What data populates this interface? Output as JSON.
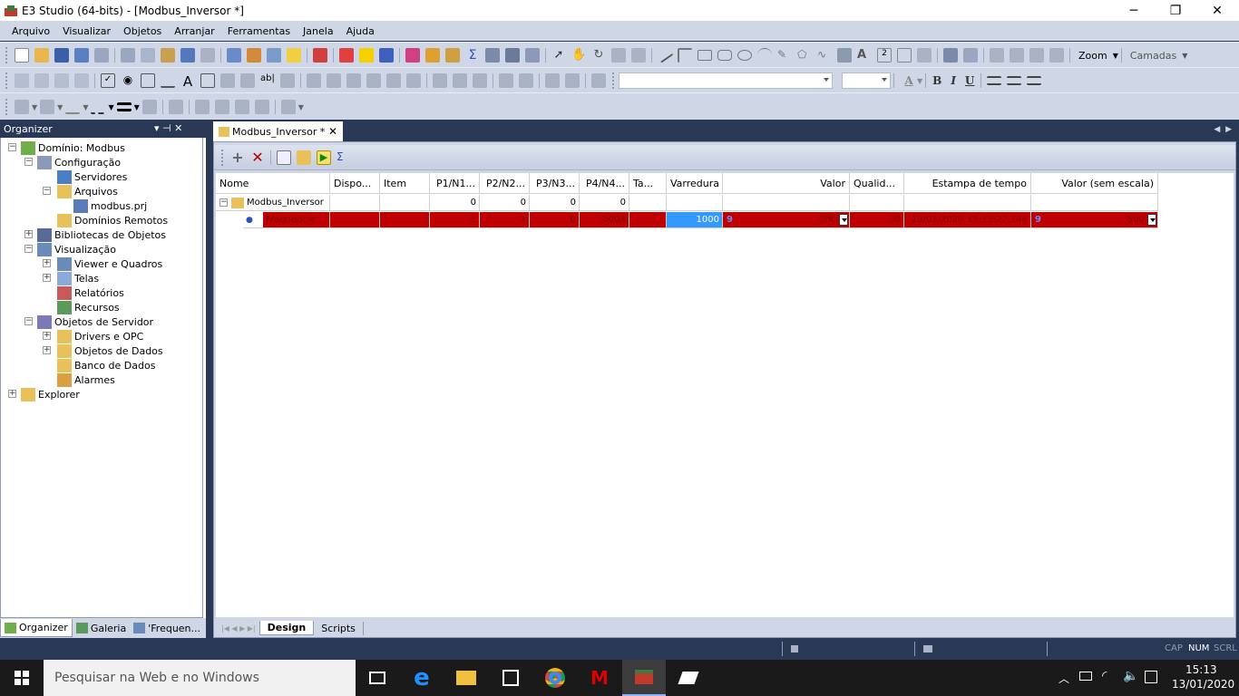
{
  "window": {
    "title": "E3 Studio (64-bits) - [Modbus_Inversor *]",
    "minimize": "─",
    "maximize": "❐",
    "close": "✕"
  },
  "menu": [
    "Arquivo",
    "Visualizar",
    "Objetos",
    "Arranjar",
    "Ferramentas",
    "Janela",
    "Ajuda"
  ],
  "toolbar": {
    "zoom": "Zoom",
    "camadas": "Camadas"
  },
  "organizer": {
    "title": "Organizer",
    "pin": "▾  ⊣  ✕",
    "tree": [
      "Domínio: Modbus",
      "Configuração",
      "Servidores",
      "Arquivos",
      "modbus.prj",
      "Domínios Remotos",
      "Bibliotecas de Objetos",
      "Visualização",
      "Viewer e Quadros",
      "Telas",
      "Relatórios",
      "Recursos",
      "Objetos de Servidor",
      "Drivers e OPC",
      "Objetos de Dados",
      "Banco de Dados",
      "Alarmes",
      "Explorer"
    ],
    "tabs": [
      "Organizer",
      "Galeria",
      "'Frequen..."
    ]
  },
  "document": {
    "tab": "Modbus_Inversor *",
    "columns": [
      "Nome",
      "Dispo...",
      "Item",
      "P1/N1...",
      "P2/N2...",
      "P3/N3...",
      "P4/N4...",
      "Ta...",
      "Varredura",
      "Valor",
      "Qualid...",
      "Estampa de tempo",
      "Valor (sem escala)"
    ],
    "driver_row": {
      "name": "Modbus_Inversor",
      "p1": "0",
      "p2": "0",
      "p3": "0",
      "p4": "0"
    },
    "tag_row": {
      "name": "Frequencia",
      "p1": "1",
      "p2": "1",
      "p3": "0",
      "p4": "5004",
      "varredura": "1000",
      "valor_icon": "9",
      "valor": "500",
      "qualidade": "20",
      "timestamp": "13/01/2020 15:13:27.144",
      "raw_icon": "9",
      "raw": "500"
    },
    "bottom_tabs": [
      "Design",
      "Scripts"
    ]
  },
  "status": {
    "cap": "CAP",
    "num": "NUM",
    "scrl": "SCRL"
  },
  "taskbar": {
    "search": "Pesquisar na Web e no Windows",
    "time": "15:13",
    "date": "13/01/2020"
  },
  "colors": {
    "accent": "#293955",
    "chrome": "#cfd6e5",
    "alarm_row": "#c00000",
    "selected_cell": "#3399ff"
  }
}
